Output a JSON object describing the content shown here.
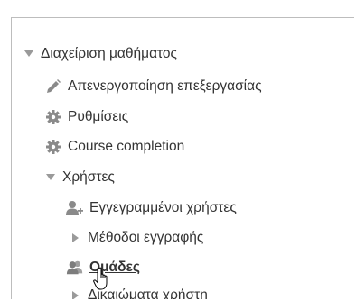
{
  "tree": {
    "course_admin": {
      "label": "Διαχείριση μαθήματος",
      "icon": "triangle-down-icon"
    },
    "items": [
      {
        "label": "Απενεργοποίηση επεξεργασίας",
        "icon": "pencil-icon"
      },
      {
        "label": "Ρυθμίσεις",
        "icon": "gear-icon"
      },
      {
        "label": "Course completion",
        "icon": "gear-icon"
      }
    ],
    "users": {
      "label": "Χρήστες",
      "icon": "triangle-down-icon",
      "children": [
        {
          "label": "Εγγεγραμμένοι χρήστες",
          "icon": "enrolled-users-icon"
        },
        {
          "label": "Μέθοδοι εγγραφής",
          "icon": "triangle-right-icon"
        },
        {
          "label": "Ομάδες",
          "icon": "groups-icon"
        },
        {
          "label": "Δικαιώματα χρήστη",
          "icon": "triangle-right-icon"
        }
      ]
    }
  },
  "colors": {
    "text": "#333333",
    "icon_gray": "#8a8a8a",
    "caret_gray": "#9a9a9a",
    "border": "#bdbdbd"
  }
}
